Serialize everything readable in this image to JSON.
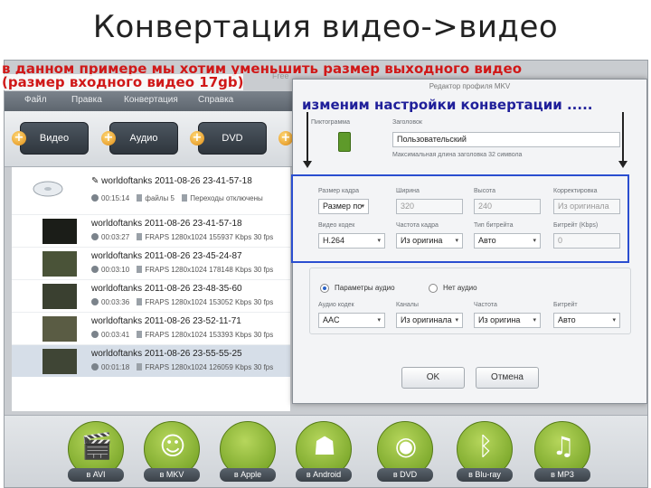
{
  "slide_title": "Конвертация видео->видео",
  "annotations": {
    "line1": "в данном примере мы хотим  уменьшить размер выходного видео",
    "line2": "(размер входного видео 17gb)",
    "dialog_note": "изменим настройки конвертации ....."
  },
  "app_stub": "Free",
  "menu": [
    "Файл",
    "Правка",
    "Конвертация",
    "Справка"
  ],
  "toolbar": [
    {
      "label": "Видео"
    },
    {
      "label": "Аудио"
    },
    {
      "label": "DVD"
    }
  ],
  "group": {
    "name": "worldoftanks 2011-08-26 23-41-57-18",
    "duration": "00:15:14",
    "files": "файлы 5",
    "transitions": "Переходы отключены"
  },
  "files": [
    {
      "name": "worldoftanks 2011-08-26 23-41-57-18",
      "duration": "00:03:27",
      "meta": "FRAPS  1280x1024  155937 Kbps  30 fps"
    },
    {
      "name": "worldoftanks 2011-08-26 23-45-24-87",
      "duration": "00:03:10",
      "meta": "FRAPS  1280x1024  178148 Kbps  30 fps"
    },
    {
      "name": "worldoftanks 2011-08-26 23-48-35-60",
      "duration": "00:03:36",
      "meta": "FRAPS  1280x1024  153052 Kbps  30 fps"
    },
    {
      "name": "worldoftanks 2011-08-26 23-52-11-71",
      "duration": "00:03:41",
      "meta": "FRAPS  1280x1024  153393 Kbps  30 fps"
    },
    {
      "name": "worldoftanks 2011-08-26 23-55-55-25",
      "duration": "00:01:18",
      "meta": "FRAPS  1280x1024  126059 Kbps  30 fps"
    }
  ],
  "dialog": {
    "title": "Редактор профиля MKV",
    "icon_label": "Пиктограмма",
    "header_label": "Заголовок",
    "header_value": "Пользовательский",
    "header_hint": "Максимальная длина заголовка 32 символа",
    "frame_size_label": "Размер кадра",
    "frame_size_value": "Размер по",
    "width_label": "Ширина",
    "width_value": "320",
    "height_label": "Высота",
    "height_value": "240",
    "aspect_label": "Корректировка",
    "aspect_value": "Из оригинала",
    "vcodec_label": "Видео кодек",
    "vcodec_value": "H.264",
    "fps_label": "Частота кадра",
    "fps_value": "Из оригина",
    "bitrate_type_label": "Тип битрейта",
    "bitrate_type_value": "Авто",
    "bitrate_label": "Битрейт (Kbps)",
    "bitrate_value": "0",
    "audio_on": "Параметры аудио",
    "audio_off": "Нет аудио",
    "acodec_label": "Аудио кодек",
    "acodec_value": "AAC",
    "channels_label": "Каналы",
    "channels_value": "Из оригинала",
    "freq_label": "Частота",
    "freq_value": "Из оригина",
    "abitrate_label": "Битрейт",
    "abitrate_value": "Авто",
    "ok": "OK",
    "cancel": "Отмена"
  },
  "outputs": [
    {
      "label": "в AVI",
      "icon": "film-clapper-icon",
      "glyph": "🎬"
    },
    {
      "label": "в MKV",
      "icon": "matryoshka-icon",
      "glyph": "☺"
    },
    {
      "label": "в Apple",
      "icon": "apple-icon",
      "glyph": ""
    },
    {
      "label": "в Android",
      "icon": "android-icon",
      "glyph": "☗"
    },
    {
      "label": "в DVD",
      "icon": "dvd-disc-icon",
      "glyph": "◉"
    },
    {
      "label": "в Blu-ray",
      "icon": "bluray-icon",
      "glyph": "ᛒ"
    },
    {
      "label": "в MP3",
      "icon": "earphones-icon",
      "glyph": "♫"
    }
  ],
  "colors": {
    "annotation_red": "#d01818",
    "annotation_blue": "#1f1f9a",
    "highlight_box": "#2a4ed0",
    "output_green": "#7fb02a"
  }
}
